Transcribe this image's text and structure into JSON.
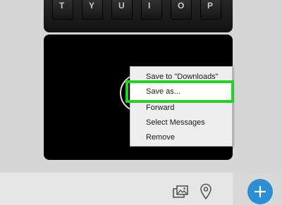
{
  "keyboard_photo": {
    "keys": [
      "T",
      "Y",
      "U",
      "I",
      "O",
      "P"
    ]
  },
  "context_menu": {
    "items": [
      {
        "label": "Save to \"Downloads\""
      },
      {
        "label": "Save as..."
      },
      {
        "label": "Forward"
      },
      {
        "label": "Select Messages"
      },
      {
        "label": "Remove"
      }
    ],
    "highlighted_item": "Save as..."
  },
  "bottom_bar": {
    "icons": [
      "gallery-icon",
      "location-icon",
      "plus-icon"
    ]
  },
  "colors": {
    "highlight": "#25d125",
    "fab": "#2b8fd6",
    "background": "#d6d6d6"
  }
}
